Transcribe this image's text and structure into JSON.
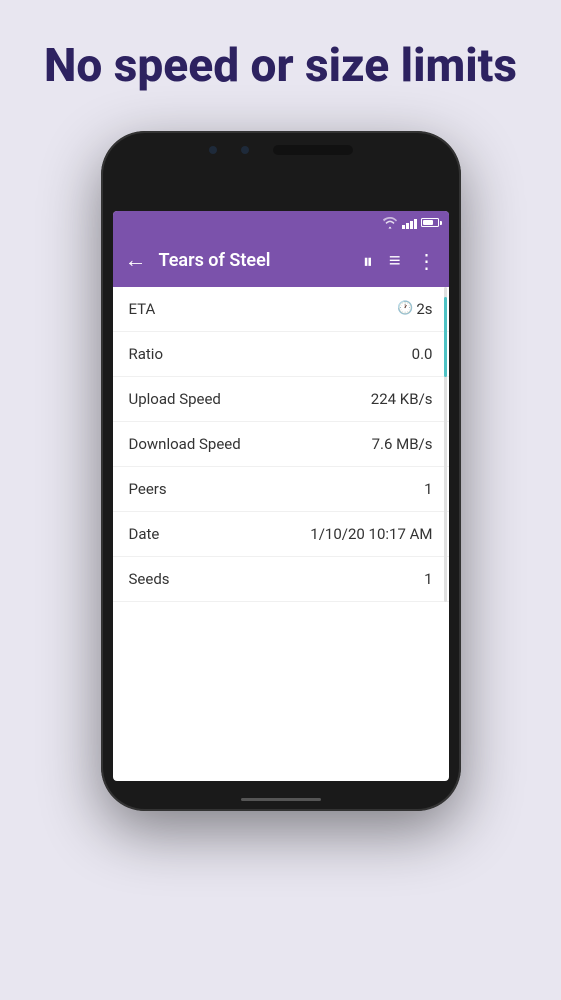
{
  "page": {
    "background_color": "#e8e6f0",
    "headline": "No speed or size limits"
  },
  "toolbar": {
    "back_icon": "←",
    "title": "Tears of Steel",
    "pause_icon": "⏸",
    "list_icon": "≡",
    "more_icon": "⋮"
  },
  "stats": [
    {
      "label": "ETA",
      "value": "2s",
      "has_icon": true
    },
    {
      "label": "Ratio",
      "value": "0.0",
      "has_icon": false
    },
    {
      "label": "Upload Speed",
      "value": "224 KB/s",
      "has_icon": false
    },
    {
      "label": "Download Speed",
      "value": "7.6 MB/s",
      "has_icon": false
    },
    {
      "label": "Peers",
      "value": "1",
      "has_icon": false
    },
    {
      "label": "Date",
      "value": "1/10/20 10:17 AM",
      "has_icon": false
    },
    {
      "label": "Seeds",
      "value": "1",
      "has_icon": false
    }
  ]
}
